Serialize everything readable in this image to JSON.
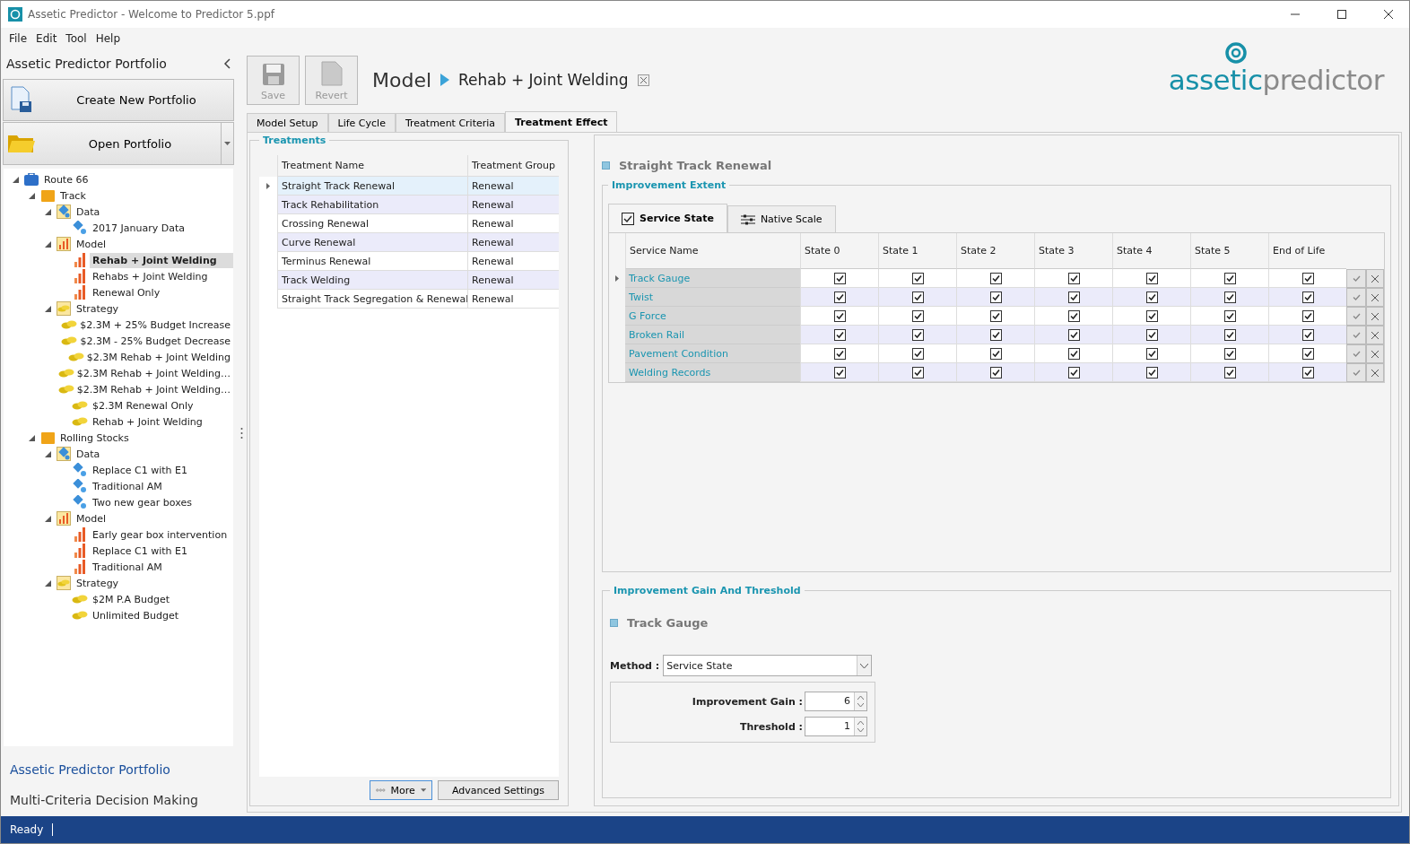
{
  "window": {
    "title": "Assetic Predictor - Welcome to Predictor 5.ppf"
  },
  "menu": [
    "File",
    "Edit",
    "Tool",
    "Help"
  ],
  "sidebar": {
    "title": "Assetic Predictor Portfolio",
    "buttons": [
      {
        "label": "Create New Portfolio",
        "kind": "new",
        "dropdown": false
      },
      {
        "label": "Open Portfolio",
        "kind": "open",
        "dropdown": true
      }
    ],
    "tree": [
      {
        "label": "Route 66",
        "kind": "route",
        "selected": false,
        "expanded": true,
        "children": [
          {
            "label": "Track",
            "kind": "group",
            "selected": false,
            "expanded": true,
            "children": [
              {
                "label": "Data",
                "kind": "data",
                "selected": false,
                "expanded": true,
                "children": [
                  {
                    "label": "2017 January Data",
                    "kind": "dataset",
                    "selected": false
                  }
                ]
              },
              {
                "label": "Model",
                "kind": "model",
                "selected": false,
                "expanded": true,
                "children": [
                  {
                    "label": "Rehab + Joint Welding",
                    "kind": "modelitem",
                    "selected": true
                  },
                  {
                    "label": "Rehabs + Joint Welding",
                    "kind": "modelitem",
                    "selected": false
                  },
                  {
                    "label": "Renewal Only",
                    "kind": "modelitem",
                    "selected": false
                  }
                ]
              },
              {
                "label": "Strategy",
                "kind": "strategy",
                "selected": false,
                "expanded": true,
                "children": [
                  {
                    "label": "$2.3M + 25% Budget Increase",
                    "kind": "strategyitem",
                    "selected": false
                  },
                  {
                    "label": "$2.3M - 25% Budget Decrease",
                    "kind": "strategyitem",
                    "selected": false
                  },
                  {
                    "label": "$2.3M Rehab + Joint Welding",
                    "kind": "strategyitem",
                    "selected": false
                  },
                  {
                    "label": "$2.3M Rehab + Joint Welding…",
                    "kind": "strategyitem",
                    "selected": false
                  },
                  {
                    "label": "$2.3M Rehab + Joint Welding…",
                    "kind": "strategyitem",
                    "selected": false
                  },
                  {
                    "label": "$2.3M Renewal Only",
                    "kind": "strategyitem",
                    "selected": false
                  },
                  {
                    "label": "Rehab + Joint Welding",
                    "kind": "strategyitem",
                    "selected": false
                  }
                ]
              }
            ]
          },
          {
            "label": "Rolling Stocks",
            "kind": "group",
            "selected": false,
            "expanded": true,
            "children": [
              {
                "label": "Data",
                "kind": "data",
                "selected": false,
                "expanded": true,
                "children": [
                  {
                    "label": "Replace C1 with E1",
                    "kind": "dataset",
                    "selected": false
                  },
                  {
                    "label": "Traditional AM",
                    "kind": "dataset",
                    "selected": false
                  },
                  {
                    "label": "Two new gear boxes",
                    "kind": "dataset",
                    "selected": false
                  }
                ]
              },
              {
                "label": "Model",
                "kind": "model",
                "selected": false,
                "expanded": true,
                "children": [
                  {
                    "label": "Early gear box intervention",
                    "kind": "modelitem",
                    "selected": false
                  },
                  {
                    "label": "Replace C1 with E1",
                    "kind": "modelitem",
                    "selected": false
                  },
                  {
                    "label": "Traditional AM",
                    "kind": "modelitem",
                    "selected": false
                  }
                ]
              },
              {
                "label": "Strategy",
                "kind": "strategy",
                "selected": false,
                "expanded": true,
                "children": [
                  {
                    "label": "$2M P.A Budget",
                    "kind": "strategyitem",
                    "selected": false
                  },
                  {
                    "label": "Unlimited Budget",
                    "kind": "strategyitem",
                    "selected": false
                  }
                ]
              }
            ]
          }
        ]
      }
    ],
    "nav": [
      {
        "label": "Assetic Predictor Portfolio",
        "selected": true
      },
      {
        "label": "Multi-Criteria Decision Making",
        "selected": false
      }
    ]
  },
  "toolbar": [
    {
      "label": "Save",
      "kind": "save",
      "disabled": true
    },
    {
      "label": "Revert",
      "kind": "revert",
      "disabled": true
    }
  ],
  "breadcrumb": {
    "section": "Model",
    "item": "Rehab + Joint Welding"
  },
  "logo": {
    "brand": "assetic",
    "product": "predictor"
  },
  "tabs": [
    {
      "label": "Model Setup",
      "selected": false
    },
    {
      "label": "Life Cycle",
      "selected": false
    },
    {
      "label": "Treatment Criteria",
      "selected": false
    },
    {
      "label": "Treatment Effect",
      "selected": true
    }
  ],
  "treatments": {
    "title": "Treatments",
    "columns": [
      "Treatment Name",
      "Treatment Group"
    ],
    "rows": [
      {
        "name": "Straight Track Renewal",
        "group": "Renewal",
        "selected": true
      },
      {
        "name": "Track Rehabilitation",
        "group": "Renewal",
        "selected": false
      },
      {
        "name": "Crossing Renewal",
        "group": "Renewal",
        "selected": false
      },
      {
        "name": "Curve Renewal",
        "group": "Renewal",
        "selected": false
      },
      {
        "name": "Terminus Renewal",
        "group": "Renewal",
        "selected": false
      },
      {
        "name": "Track Welding",
        "group": "Renewal",
        "selected": false
      },
      {
        "name": "Straight Track Segregation & Renewal",
        "group": "Renewal",
        "selected": false
      }
    ],
    "buttons": [
      {
        "label": "More",
        "kind": "more"
      },
      {
        "label": "Advanced Settings",
        "kind": "plain"
      }
    ]
  },
  "effect": {
    "heading": "Straight Track Renewal",
    "extent": {
      "title": "Improvement Extent",
      "tabs": [
        {
          "label": "Service State",
          "kind": "check",
          "selected": true
        },
        {
          "label": "Native Scale",
          "kind": "sliders",
          "selected": false
        }
      ],
      "columns": [
        "Service Name",
        "State 0",
        "State 1",
        "State 2",
        "State 3",
        "State 4",
        "State 5",
        "End of Life"
      ],
      "rows": [
        {
          "name": "Track Gauge",
          "selected": true,
          "states": [
            {
              "checked": true
            },
            {
              "checked": true
            },
            {
              "checked": true
            },
            {
              "checked": true
            },
            {
              "checked": true
            },
            {
              "checked": true
            },
            {
              "checked": true
            }
          ]
        },
        {
          "name": "Twist",
          "selected": false,
          "states": [
            {
              "checked": true
            },
            {
              "checked": true
            },
            {
              "checked": true
            },
            {
              "checked": true
            },
            {
              "checked": true
            },
            {
              "checked": true
            },
            {
              "checked": true
            }
          ]
        },
        {
          "name": "G Force",
          "selected": false,
          "states": [
            {
              "checked": true
            },
            {
              "checked": true
            },
            {
              "checked": true
            },
            {
              "checked": true
            },
            {
              "checked": true
            },
            {
              "checked": true
            },
            {
              "checked": true
            }
          ]
        },
        {
          "name": "Broken Rail",
          "selected": false,
          "states": [
            {
              "checked": true
            },
            {
              "checked": true
            },
            {
              "checked": true
            },
            {
              "checked": true
            },
            {
              "checked": true
            },
            {
              "checked": true
            },
            {
              "checked": true
            }
          ]
        },
        {
          "name": "Pavement Condition",
          "selected": false,
          "states": [
            {
              "checked": true
            },
            {
              "checked": true
            },
            {
              "checked": true
            },
            {
              "checked": true
            },
            {
              "checked": true
            },
            {
              "checked": true
            },
            {
              "checked": true
            }
          ]
        },
        {
          "name": "Welding Records",
          "selected": false,
          "states": [
            {
              "checked": true
            },
            {
              "checked": true
            },
            {
              "checked": true
            },
            {
              "checked": true
            },
            {
              "checked": true
            },
            {
              "checked": true
            },
            {
              "checked": true
            }
          ]
        }
      ]
    },
    "gain": {
      "title": "Improvement Gain And Threshold",
      "heading": "Track Gauge",
      "method_label": "Method :",
      "method": "Service State",
      "fields": [
        {
          "label": "Improvement Gain :",
          "value": "6"
        },
        {
          "label": "Threshold :",
          "value": "1"
        }
      ]
    }
  },
  "status_bar": {
    "text": "Ready"
  }
}
